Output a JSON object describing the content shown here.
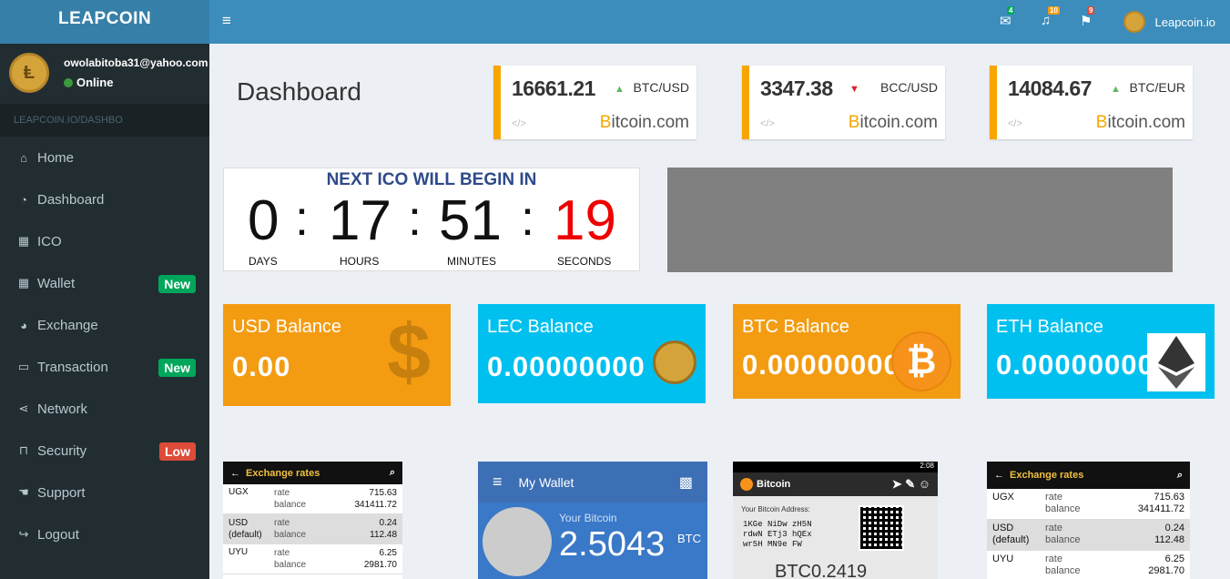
{
  "brand": "LEAPCOIN",
  "user": {
    "email": "owolabitoba31@yahoo.com",
    "status": "Online"
  },
  "breadcrumb": "LEAPCOIN.IO/DASHBO",
  "menu": [
    {
      "label": "Home",
      "icon": "home-icon",
      "badge": ""
    },
    {
      "label": "Dashboard",
      "icon": "dashboard-icon",
      "badge": ""
    },
    {
      "label": "ICO",
      "icon": "grid-icon",
      "badge": ""
    },
    {
      "label": "Wallet",
      "icon": "grid-icon",
      "badge": "New"
    },
    {
      "label": "Exchange",
      "icon": "pie-chart-icon",
      "badge": ""
    },
    {
      "label": "Transaction",
      "icon": "laptop-icon",
      "badge": "New"
    },
    {
      "label": "Network",
      "icon": "share-icon",
      "badge": ""
    },
    {
      "label": "Security",
      "icon": "unlock-icon",
      "badge": "Low"
    },
    {
      "label": "Support",
      "icon": "hand-icon",
      "badge": ""
    },
    {
      "label": "Logout",
      "icon": "logout-icon",
      "badge": ""
    }
  ],
  "topbar": {
    "messages": "4",
    "notifications": "10",
    "flags": "9",
    "username": "Leapcoin.io"
  },
  "page_title": "Dashboard",
  "tickers": [
    {
      "price": "16661.21",
      "pair": "BTC/USD",
      "dir": "up"
    },
    {
      "price": "3347.38",
      "pair": "BCC/USD",
      "dir": "down"
    },
    {
      "price": "14084.67",
      "pair": "BTC/EUR",
      "dir": "up"
    }
  ],
  "ticker_code": "</>",
  "ticker_brand_b": "B",
  "ticker_brand_rest": "itcoin.com",
  "countdown": {
    "title": "NEXT ICO WILL BEGIN IN",
    "days": "0",
    "hours": "17",
    "minutes": "51",
    "seconds": "19",
    "labels": [
      "DAYS",
      "HOURS",
      "MINUTES",
      "SECONDS"
    ]
  },
  "balances": [
    {
      "title": "USD Balance",
      "value": "0.00"
    },
    {
      "title": "LEC Balance",
      "value": "0.00000000"
    },
    {
      "title": "BTC Balance",
      "value": "0.00000000"
    },
    {
      "title": "ETH Balance",
      "value": "0.00000000"
    }
  ],
  "exchange": {
    "title": "Exchange rates",
    "rows": [
      {
        "cur": "UGX",
        "cur2": "",
        "rate": "715.63",
        "balance": "341411.72"
      },
      {
        "cur": "USD",
        "cur2": "(default)",
        "rate": "0.24",
        "balance": "112.48"
      },
      {
        "cur": "UYU",
        "cur2": "",
        "rate": "6.25",
        "balance": "2981.70"
      }
    ],
    "rate_label": "rate",
    "balance_label": "balance"
  },
  "wallet": {
    "title": "My Wallet",
    "your": "Your Bitcoin",
    "amount": "2.5043",
    "unit": "BTC"
  },
  "btcapp": {
    "title": "Bitcoin",
    "time": "2:08",
    "addr_label": "Your Bitcoin Address:",
    "addr": [
      "1KGe NiDw zH5N",
      "rdwN ETj3 hQEx",
      "wr5H MN9e FW"
    ],
    "amount": "BTC0.2419"
  }
}
